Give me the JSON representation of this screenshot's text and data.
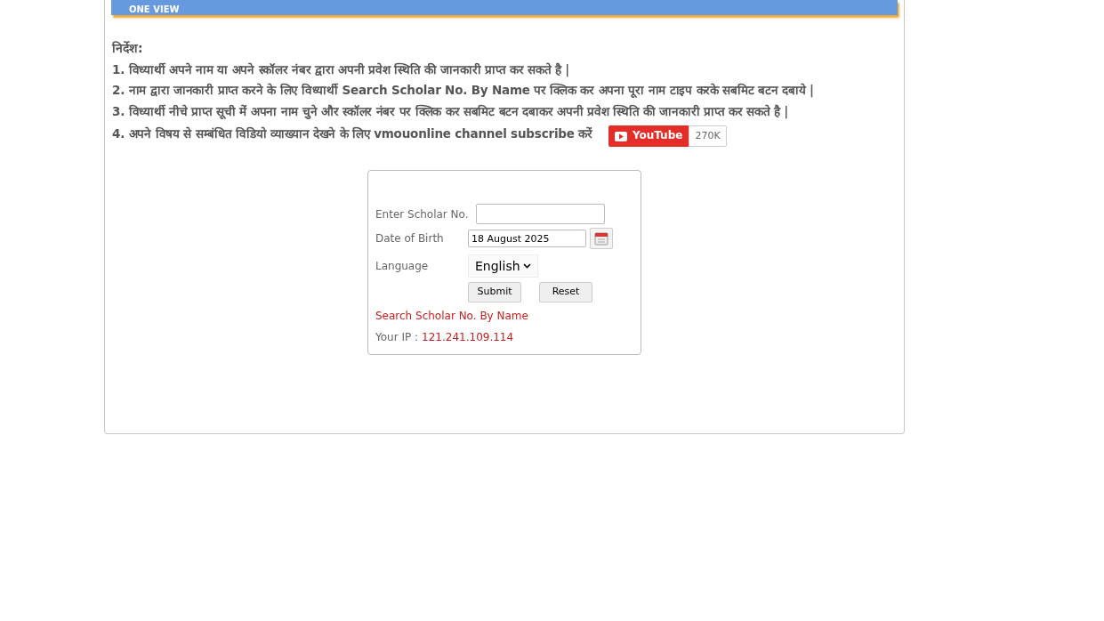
{
  "header": {
    "title": "ONE VIEW"
  },
  "instructions": {
    "heading": "निर्देश:",
    "items": [
      "1. विध्यार्थी अपने नाम या अपने स्कॉलर नंबर द्वारा अपनी प्रवेश स्थिति की जानकारी प्राप्त कर सकते है |",
      "2. नाम द्वारा जानकारी प्राप्त करने के लिए विध्यार्थी **Search Scholar No. By Name** पर क्लिक कर अपना पूरा नाम टाइप करके सबमिट बटन दबाये |",
      "3. विध्यार्थी नीचे प्राप्त सूची में अपना नाम चुने और स्कॉलर नंबर पर क्लिक कर सबमिट बटन दबाकर अपनी प्रवेश स्थिति की जानकारी प्राप्त कर सकते है |",
      "4. अपने विषय से सम्बंधित विडियो व्याख्यान देखने के लिए **vmouonline channel subscribe** करें"
    ],
    "youtube": {
      "label": "YouTube",
      "count": "270K"
    }
  },
  "form": {
    "scholar_label": "Enter Scholar No.",
    "dob_label": "Date of Birth",
    "dob_value": "18 August 2025",
    "language_label": "Language",
    "language_value": "English",
    "submit": "Submit",
    "reset": "Reset",
    "search_link": "Search Scholar No. By Name",
    "ip_label": "Your IP :",
    "ip_value": "121.241.109.114"
  }
}
